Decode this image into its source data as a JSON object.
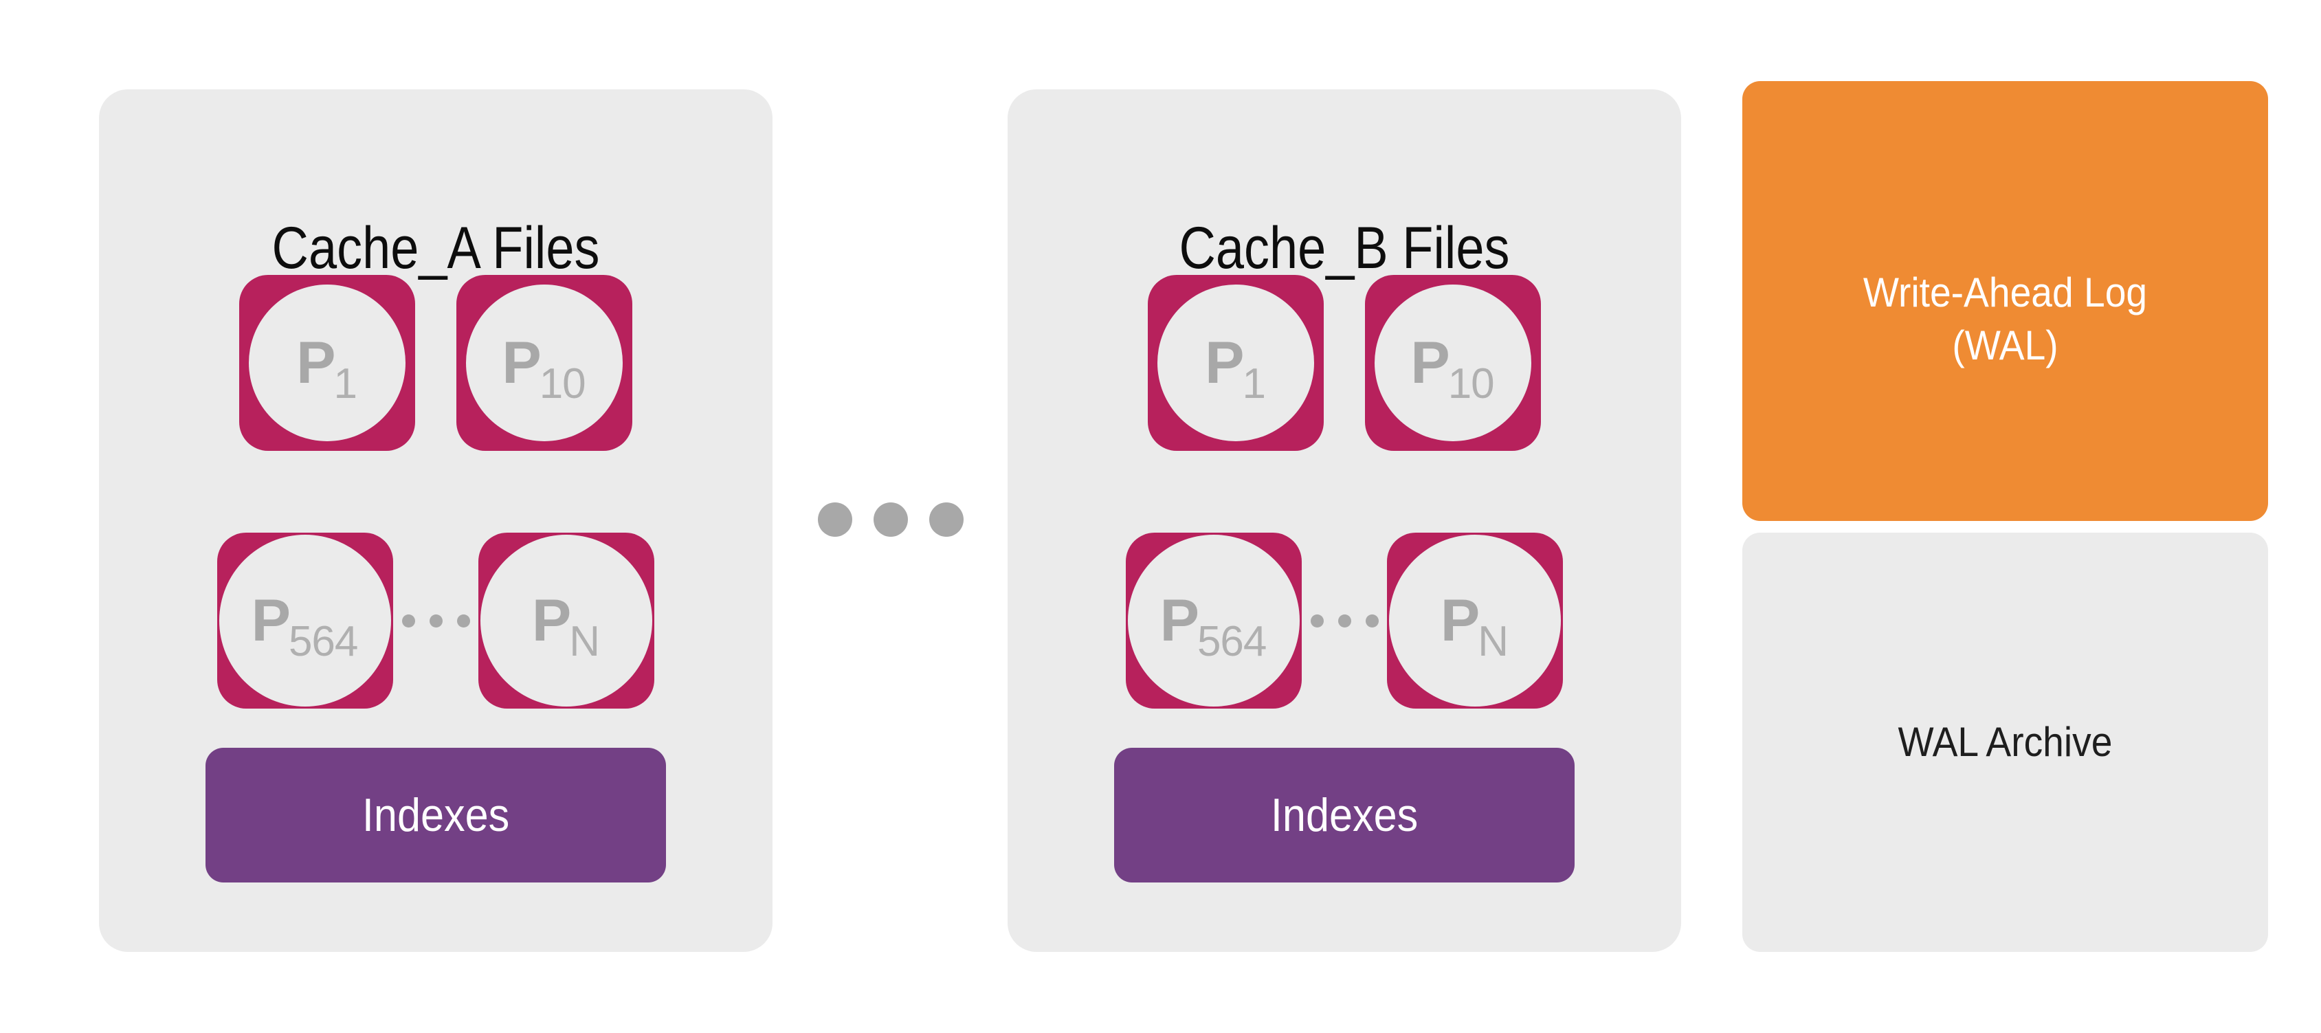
{
  "diagram": {
    "background_color": "#ffffff",
    "colors": {
      "panel_gray": "#ebebeb",
      "page_tile_crimson": "#b7215c",
      "indexes_purple": "#734085",
      "wal_orange": "#ef8b33",
      "dot_gray": "#a8a8a8",
      "page_label_gray": "#a8a8a8",
      "title_black": "#0d0d0d"
    },
    "cache_panels": [
      {
        "id": "cache-a",
        "title": "Cache_A Files",
        "row1": [
          {
            "base": "P",
            "subscript": "1"
          },
          {
            "base": "P",
            "subscript": "10"
          }
        ],
        "row2": [
          {
            "base": "P",
            "subscript": "564"
          },
          {
            "base": "P",
            "subscript": "N"
          }
        ],
        "row2_separator": "ellipsis",
        "indexes_label": "Indexes"
      },
      {
        "id": "cache-b",
        "title": "Cache_B Files",
        "row1": [
          {
            "base": "P",
            "subscript": "1"
          },
          {
            "base": "P",
            "subscript": "10"
          }
        ],
        "row2": [
          {
            "base": "P",
            "subscript": "564"
          },
          {
            "base": "P",
            "subscript": "N"
          }
        ],
        "row2_separator": "ellipsis",
        "indexes_label": "Indexes"
      }
    ],
    "center_separator": {
      "icon": "horizontal-ellipsis-icon",
      "dot_count": 3
    },
    "right_column": {
      "wal": {
        "line1": "Write-Ahead Log",
        "line2": "(WAL)"
      },
      "wal_archive": {
        "label": "WAL Archive"
      }
    }
  }
}
